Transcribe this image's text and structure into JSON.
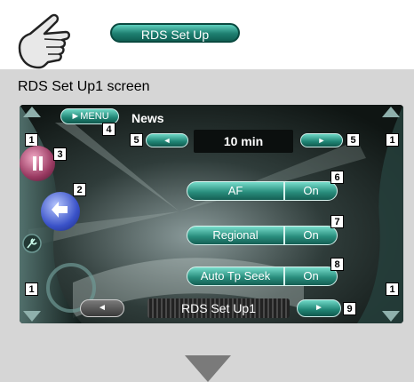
{
  "header": {
    "pill_label": "RDS Set Up"
  },
  "subtitle": "RDS Set Up1 screen",
  "panel": {
    "menu_label": "►MENU",
    "section_title": "News",
    "time_value": "10 min",
    "settings": [
      {
        "label": "AF",
        "value": "On"
      },
      {
        "label": "Regional",
        "value": "On"
      },
      {
        "label": "Auto Tp Seek",
        "value": "On"
      }
    ],
    "bottom_title": "RDS  Set Up1",
    "left_arrow": "◄",
    "right_arrow": "►"
  },
  "callouts": [
    "1",
    "2",
    "3",
    "4",
    "5",
    "6",
    "7",
    "8",
    "9"
  ],
  "colors": {
    "teal": "#2a8f7e",
    "panel": "#121a18"
  }
}
